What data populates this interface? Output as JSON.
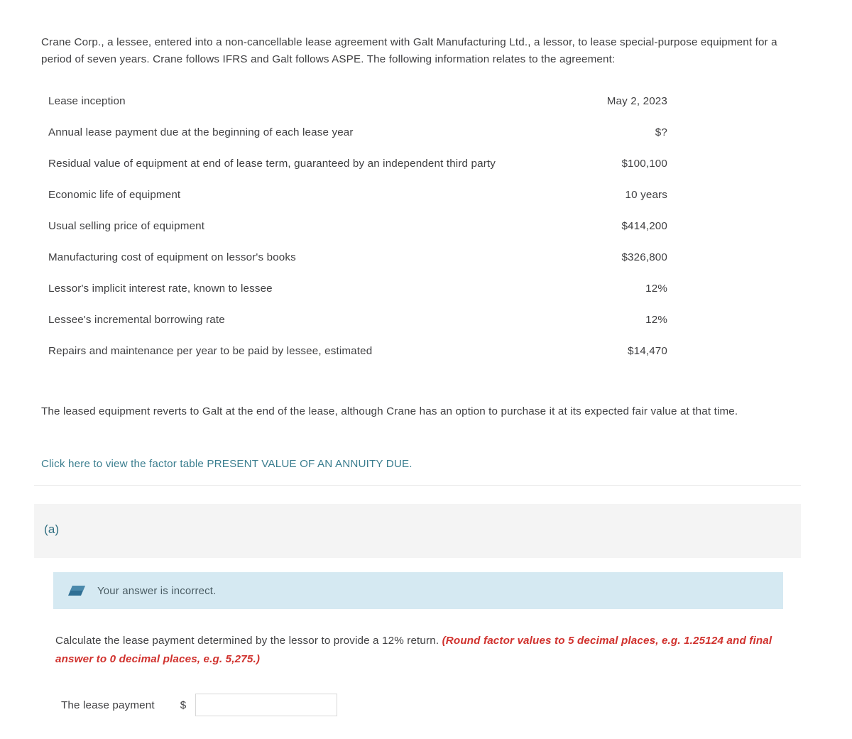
{
  "problem": {
    "intro": "Crane Corp., a lessee, entered into a non-cancellable lease agreement with Galt Manufacturing Ltd., a lessor, to lease special-purpose equipment for a period of seven years. Crane follows IFRS and Galt follows ASPE. The following information relates to the agreement:",
    "facts": [
      {
        "label": "Lease inception",
        "value": "May 2, 2023"
      },
      {
        "label": "Annual lease payment due at the beginning of each lease year",
        "value": "$?"
      },
      {
        "label": "Residual value of equipment at end of lease term, guaranteed by an independent third party",
        "value": "$100,100"
      },
      {
        "label": "Economic life of equipment",
        "value": "10 years"
      },
      {
        "label": "Usual selling price of equipment",
        "value": "$414,200"
      },
      {
        "label": "Manufacturing cost of equipment on lessor's books",
        "value": "$326,800"
      },
      {
        "label": "Lessor's implicit interest rate, known to lessee",
        "value": "12%"
      },
      {
        "label": "Lessee's incremental borrowing rate",
        "value": "12%"
      },
      {
        "label": "Repairs and maintenance per year to be paid by lessee, estimated",
        "value": "$14,470"
      }
    ],
    "reverts_note": "The leased equipment reverts to Galt at the end of the lease, although Crane has an option to purchase it at its expected fair value at that time.",
    "factor_table_link": "Click here to view the factor table PRESENT VALUE OF AN ANNUITY DUE."
  },
  "part_a": {
    "label": "(a)",
    "banner": {
      "icon": "eraser-icon",
      "text": "Your answer is incorrect."
    },
    "prompt_main": "Calculate the lease payment determined by the lessor to provide a 12% return. ",
    "prompt_note": "(Round factor values to 5 decimal places, e.g. 1.25124 and final answer to 0 decimal places, e.g. 5,275.)",
    "answer": {
      "label": "The lease payment",
      "currency_symbol": "$",
      "value": "",
      "placeholder": ""
    }
  },
  "colors": {
    "link": "#3b7e8f",
    "part_label": "#2f6e80",
    "banner_bg": "#d5e9f2",
    "banner_icon": "#2f6f94",
    "note_red": "#d0312d",
    "band_bg": "#f4f4f4",
    "divider": "#e6e6e6",
    "text": "#3f3f41"
  }
}
